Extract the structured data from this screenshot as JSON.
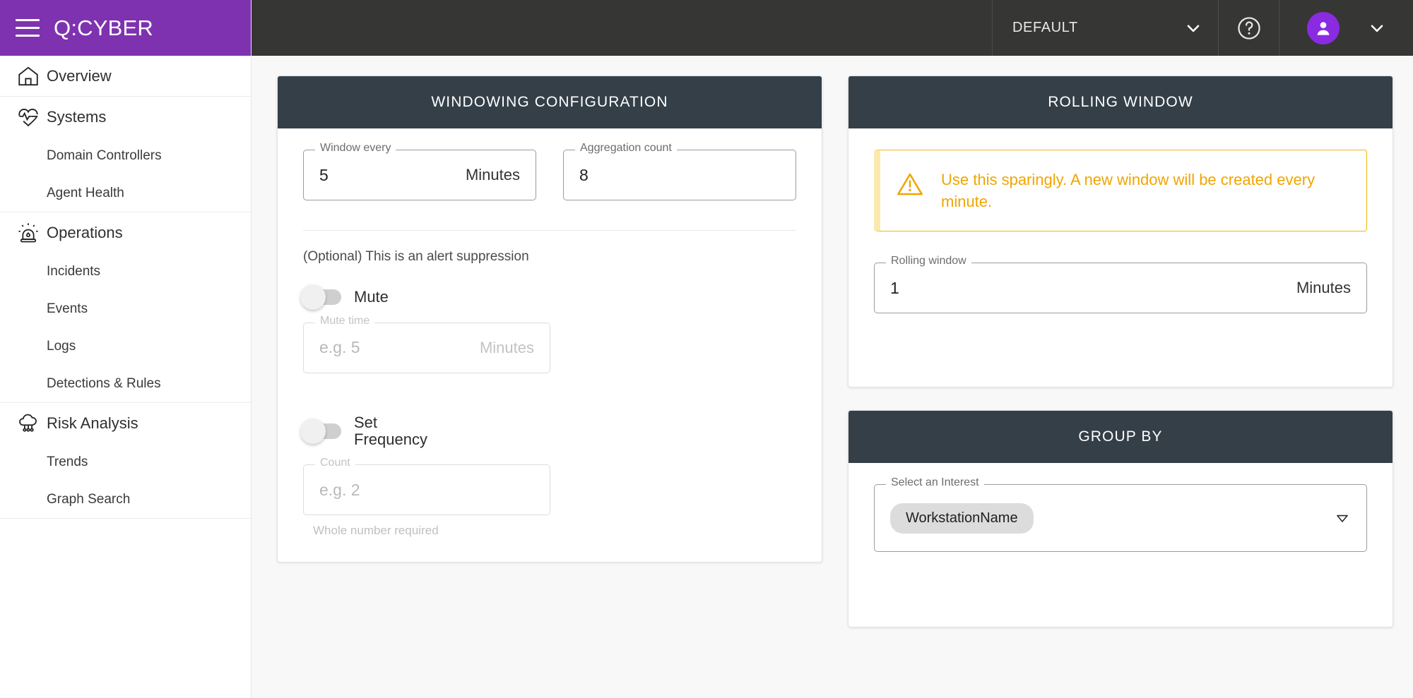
{
  "brand": {
    "title": "Q:CYBER",
    "menu_icon": "hamburger-icon",
    "purple": "#7e32b0"
  },
  "topbar": {
    "environment": "DEFAULT",
    "environment_chevron_icon": "chevron-down-icon",
    "help_icon": "question-circle-icon",
    "avatar_icon": "person-icon",
    "user_chevron_icon": "chevron-down-icon",
    "background": "#363635"
  },
  "sidebar": {
    "groups": [
      {
        "items": [
          {
            "label": "Overview",
            "icon": "home-icon",
            "level": "top"
          }
        ]
      },
      {
        "items": [
          {
            "label": "Systems",
            "icon": "heartbeat-icon",
            "level": "top"
          },
          {
            "label": "Domain Controllers",
            "icon": "",
            "level": "sub"
          },
          {
            "label": "Agent Health",
            "icon": "",
            "level": "sub"
          }
        ]
      },
      {
        "items": [
          {
            "label": "Operations",
            "icon": "siren-icon",
            "level": "top"
          },
          {
            "label": "Incidents",
            "icon": "",
            "level": "sub"
          },
          {
            "label": "Events",
            "icon": "",
            "level": "sub"
          },
          {
            "label": "Logs",
            "icon": "",
            "level": "sub"
          },
          {
            "label": "Detections & Rules",
            "icon": "",
            "level": "sub"
          }
        ]
      },
      {
        "items": [
          {
            "label": "Risk Analysis",
            "icon": "cloud-risk-icon",
            "level": "top"
          },
          {
            "label": "Trends",
            "icon": "",
            "level": "sub"
          },
          {
            "label": "Graph Search",
            "icon": "",
            "level": "sub"
          }
        ]
      }
    ]
  },
  "windowing_card": {
    "title": "WINDOWING CONFIGURATION",
    "window_every": {
      "label": "Window every",
      "value": "5",
      "suffix": "Minutes"
    },
    "aggregation_count": {
      "label": "Aggregation count",
      "value": "8",
      "suffix": ""
    },
    "suppression_text": "(Optional) This is an alert suppression",
    "mute": {
      "toggle_label": "Mute",
      "enabled": false,
      "time_label": "Mute time",
      "time_placeholder": "e.g. 5",
      "time_value": "",
      "suffix": "Minutes"
    },
    "set_frequency": {
      "toggle_label": "Set Frequency",
      "enabled": false,
      "count_label": "Count",
      "count_placeholder": "e.g. 2",
      "count_value": "",
      "hint": "Whole number required"
    }
  },
  "rolling_window_card": {
    "title": "ROLLING WINDOW",
    "warning": {
      "icon": "warning-triangle-icon",
      "text": "Use this sparingly. A new window will be created every minute.",
      "color": "#f0a500"
    },
    "rolling_window": {
      "label": "Rolling window",
      "value": "1",
      "suffix": "Minutes"
    }
  },
  "group_by_card": {
    "title": "GROUP BY",
    "select": {
      "label": "Select an Interest",
      "chips": [
        "WorkstationName"
      ],
      "caret_icon": "caret-down-icon"
    }
  },
  "colors": {
    "brand_purple": "#7e32b0",
    "topbar_dark": "#363635",
    "card_header": "#343f48",
    "content_bg": "#f8f8f8",
    "warning": "#f0a500"
  }
}
